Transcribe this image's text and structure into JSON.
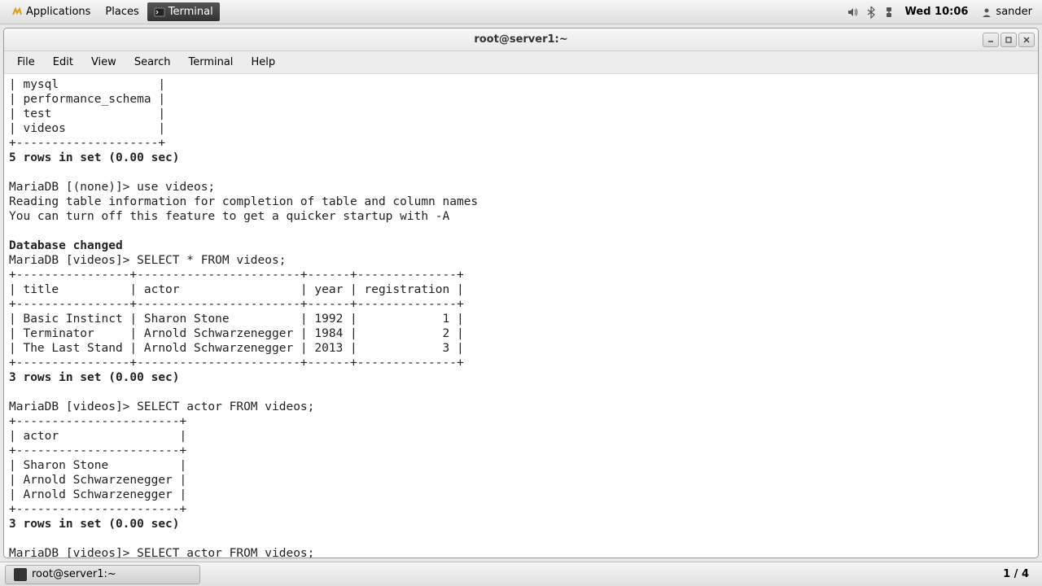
{
  "top_panel": {
    "applications": "Applications",
    "places": "Places",
    "active_task": "Terminal",
    "clock": "Wed 10:06",
    "user": "sander"
  },
  "window": {
    "title": "root@server1:~",
    "menus": {
      "file": "File",
      "edit": "Edit",
      "view": "View",
      "search": "Search",
      "terminal": "Terminal",
      "help": "Help"
    }
  },
  "terminal": {
    "db_rows": [
      "| mysql              |",
      "| performance_schema |",
      "| test               |",
      "| videos             |"
    ],
    "db_sep_end": "+--------------------+",
    "db_rows_summary": "5 rows in set (0.00 sec)",
    "prompt1": "MariaDB [(none)]> use videos;",
    "reading1": "Reading table information for completion of table and column names",
    "reading2": "You can turn off this feature to get a quicker startup with -A",
    "db_changed": "Database changed",
    "prompt2": "MariaDB [videos]> SELECT * FROM videos;",
    "t_sep": "+----------------+-----------------------+------+--------------+",
    "t_head": "| title          | actor                 | year | registration |",
    "t_r1": "| Basic Instinct | Sharon Stone          | 1992 |            1 |",
    "t_r2": "| Terminator     | Arnold Schwarzenegger | 1984 |            2 |",
    "t_r3": "| The Last Stand | Arnold Schwarzenegger | 2013 |            3 |",
    "rows3a": "3 rows in set (0.00 sec)",
    "prompt3": "MariaDB [videos]> SELECT actor FROM videos;",
    "a_sep": "+-----------------------+",
    "a_head": "| actor                 |",
    "a_r1": "| Sharon Stone          |",
    "a_r2": "| Arnold Schwarzenegger |",
    "a_r3": "| Arnold Schwarzenegger |",
    "rows3b": "3 rows in set (0.00 sec)",
    "prompt4": "MariaDB [videos]> SELECT actor FROM videos;"
  },
  "bottom_panel": {
    "task": "root@server1:~",
    "workspace": "1 / 4"
  }
}
